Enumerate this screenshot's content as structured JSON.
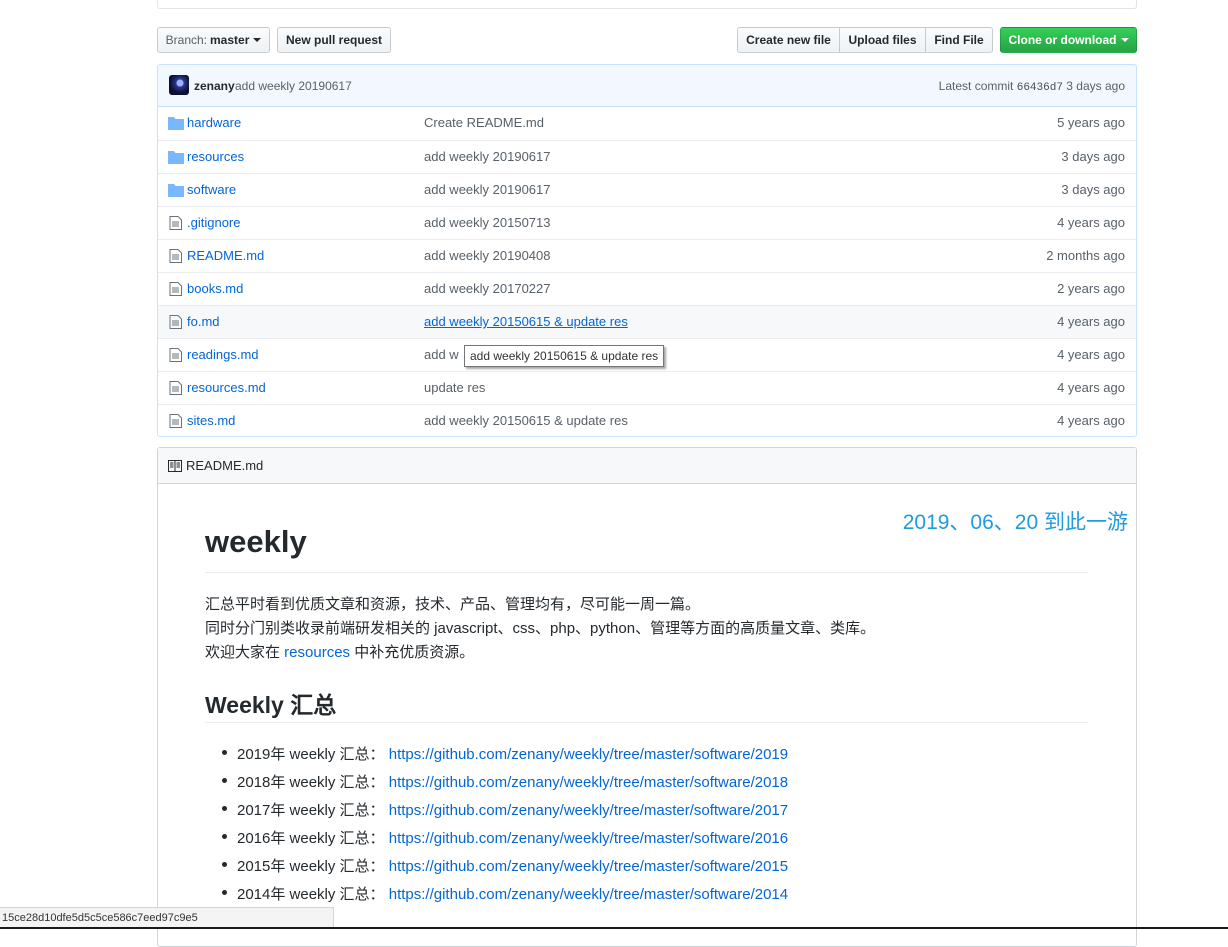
{
  "toolbar": {
    "branch_prefix": "Branch:",
    "branch_name": "master",
    "new_pull_request": "New pull request",
    "create_new_file": "Create new file",
    "upload_files": "Upload files",
    "find_file": "Find File",
    "clone_or_download": "Clone or download"
  },
  "commit": {
    "author": "zenany",
    "message": "add weekly 20190617",
    "latest_label": "Latest commit",
    "sha": "66436d7",
    "age": "3 days ago"
  },
  "files": [
    {
      "name": "hardware",
      "type": "folder",
      "commit": "Create README.md",
      "age": "5 years ago"
    },
    {
      "name": "resources",
      "type": "folder",
      "commit": "add weekly 20190617",
      "age": "3 days ago"
    },
    {
      "name": "software",
      "type": "folder",
      "commit": "add weekly 20190617",
      "age": "3 days ago"
    },
    {
      "name": ".gitignore",
      "type": "file",
      "commit": "add weekly 20150713",
      "age": "4 years ago"
    },
    {
      "name": "README.md",
      "type": "file",
      "commit": "add weekly 20190408",
      "age": "2 months ago"
    },
    {
      "name": "books.md",
      "type": "file",
      "commit": "add weekly 20170227",
      "age": "2 years ago"
    },
    {
      "name": "fo.md",
      "type": "file",
      "commit": "add weekly 20150615 & update res",
      "age": "4 years ago"
    },
    {
      "name": "readings.md",
      "type": "file",
      "commit": "add weekly 20150615 & update res",
      "age": "4 years ago"
    },
    {
      "name": "resources.md",
      "type": "file",
      "commit": "update res",
      "age": "4 years ago"
    },
    {
      "name": "sites.md",
      "type": "file",
      "commit": "add weekly 20150615 & update res",
      "age": "4 years ago"
    }
  ],
  "readings_commit_visible": "add w",
  "tooltip": "add weekly 20150615 & update res",
  "readme": {
    "header": "README.md",
    "visit_line": "2019、06、20 到此一游",
    "title": "weekly",
    "para1": "汇总平时看到优质文章和资源，技术、产品、管理均有，尽可能一周一篇。",
    "para2": "同时分门别类收录前端研发相关的 javascript、css、php、python、管理等方面的高质量文章、类库。",
    "para3_before": "欢迎大家在 ",
    "para3_link": "resources",
    "para3_after": " 中补充优质资源。",
    "section_title": "Weekly 汇总",
    "items": [
      {
        "label": "2019年 weekly 汇总： ",
        "url": "https://github.com/zenany/weekly/tree/master/software/2019"
      },
      {
        "label": "2018年 weekly 汇总： ",
        "url": "https://github.com/zenany/weekly/tree/master/software/2018"
      },
      {
        "label": "2017年 weekly 汇总： ",
        "url": "https://github.com/zenany/weekly/tree/master/software/2017"
      },
      {
        "label": "2016年 weekly 汇总： ",
        "url": "https://github.com/zenany/weekly/tree/master/software/2016"
      },
      {
        "label": "2015年 weekly 汇总： ",
        "url": "https://github.com/zenany/weekly/tree/master/software/2015"
      },
      {
        "label": "2014年 weekly 汇总： ",
        "url": "https://github.com/zenany/weekly/tree/master/software/2014"
      }
    ]
  },
  "status_bar": "15ce28d10dfe5d5c5ce586c7eed97c9e5",
  "colors": {
    "link": "#0366d6",
    "green_button": "#2cbe4e",
    "commit_bar": "#f1f8ff",
    "visit_line": "#1f9bdf"
  }
}
